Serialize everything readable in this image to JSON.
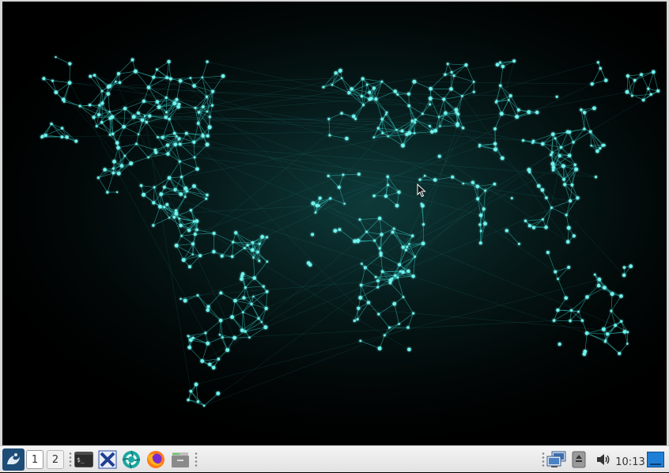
{
  "taskbar": {
    "workspaces": [
      "1",
      "2"
    ],
    "clock": "10:13",
    "launchers": [
      "terminal-icon",
      "xfce-settings-icon",
      "browser-icon",
      "firefox-icon",
      "file-manager-icon"
    ],
    "tray": [
      "network-icon",
      "removable-drive-icon",
      "volume-icon",
      "show-desktop-icon"
    ]
  },
  "colors": {
    "node": "#6ff3ee",
    "edge": "#2fbdb8",
    "glow": "#0e3a3a",
    "taskbar": "#e8e8e8"
  }
}
